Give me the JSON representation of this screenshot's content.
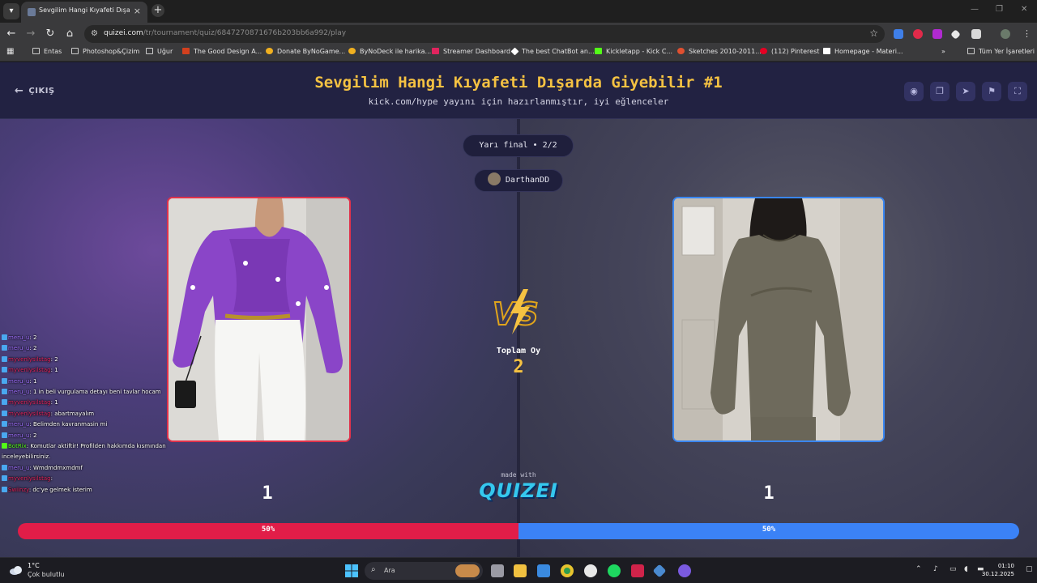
{
  "browser": {
    "tab_title": "Sevgilim Hangi Kıyafeti Dışarda",
    "url_host": "quizei.com",
    "url_path": "/tr/tournament/quiz/6847270871676b203bb6a992/play",
    "bookmarks": [
      "Entas",
      "Photoshop&Çizim",
      "Uğur",
      "The Good Design A...",
      "Donate ByNoGame...",
      "ByNoDeck ile harika...",
      "Streamer Dashboard",
      "The best ChatBot an...",
      "Kickletapp - Kick C...",
      "Sketches 2010-2011...",
      "(112) Pinterest",
      "Homepage - Materi..."
    ],
    "all_bookmarks": "Tüm Yer İşaretleri"
  },
  "header": {
    "exit_label": "ÇIKIŞ",
    "title": "Sevgilim Hangi Kıyafeti Dışarda Giyebilir #1",
    "subtitle": "kick.com/hype yayını için hazırlanmıştır, iyi eğlenceler"
  },
  "round": {
    "label": "Yarı final • 2/2",
    "creator": "DarthanDD"
  },
  "vote": {
    "label": "Toplam Oy",
    "total": "2"
  },
  "options": [
    {
      "score": "1",
      "percent_label": "50%",
      "percent": 50,
      "accent": "#e11d48"
    },
    {
      "score": "1",
      "percent_label": "50%",
      "percent": 50,
      "accent": "#3b82f6"
    }
  ],
  "brand": {
    "made_with": "made with",
    "name": "QUIZEI"
  },
  "chat": [
    {
      "user": "meru_u",
      "msg": ": 2",
      "color": "#a070ff"
    },
    {
      "user": "meru_u",
      "msg": ": 2",
      "color": "#a070ff"
    },
    {
      "user": "myvenlysilstag",
      "msg": ": 2",
      "color": "#e0245e"
    },
    {
      "user": "myvenlysilstag",
      "msg": ": 1",
      "color": "#e0245e"
    },
    {
      "user": "meru_u",
      "msg": ": 1",
      "color": "#a070ff"
    },
    {
      "user": "meru_u",
      "msg": ": 1 in beli vurgulama detayı beni tavlar hocam",
      "color": "#a070ff"
    },
    {
      "user": "myvenlysilstag",
      "msg": ": 1",
      "color": "#e0245e"
    },
    {
      "user": "myvenlysilstag",
      "msg": ": abartmayalım",
      "color": "#e0245e"
    },
    {
      "user": "meru_u",
      "msg": ": Belimden kavranmasin mi",
      "color": "#a070ff"
    },
    {
      "user": "meru_u",
      "msg": ": 2",
      "color": "#a070ff"
    },
    {
      "user": "BotRix",
      "msg": ": Komutlar aktiftir! Profilden hakkımda kısmından inceleyebilirsiniz.",
      "color": "#53fc18"
    },
    {
      "user": "meru_u",
      "msg": ": Wmdmdmxmdmf",
      "color": "#a070ff"
    },
    {
      "user": "myvenlysilstag",
      "msg": ":",
      "color": "#e0245e"
    },
    {
      "user": "Swiinzy",
      "msg": ": dc'ye gelmek isterim",
      "color": "#e0245e"
    }
  ],
  "taskbar": {
    "weather_temp": "1°C",
    "weather_desc": "Çok bulutlu",
    "search_placeholder": "Ara",
    "time": "01:10",
    "date": "30.12.2025"
  }
}
